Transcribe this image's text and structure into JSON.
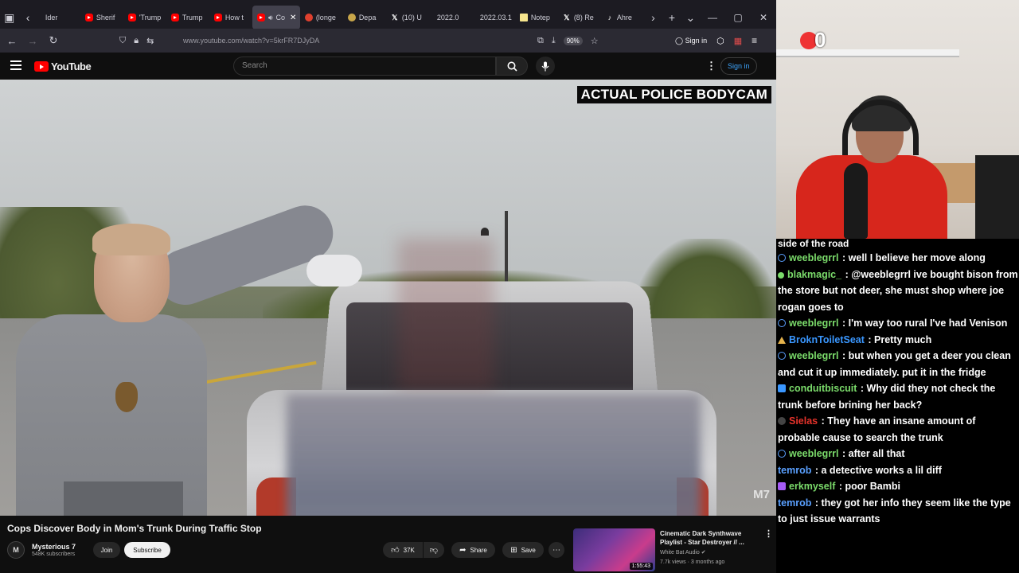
{
  "browser": {
    "tabs": [
      {
        "label": "Ider",
        "icon": "none",
        "active": false
      },
      {
        "label": "Sherif",
        "icon": "yt",
        "active": false
      },
      {
        "label": "'Trump",
        "icon": "yt",
        "active": false
      },
      {
        "label": "Trump",
        "icon": "yt",
        "active": false
      },
      {
        "label": "How t",
        "icon": "yt",
        "active": false
      },
      {
        "label": "Co",
        "icon": "yt",
        "active": true
      },
      {
        "label": "(longe",
        "icon": "red",
        "active": false
      },
      {
        "label": "Depa",
        "icon": "gold",
        "active": false
      },
      {
        "label": "(10) U",
        "icon": "x",
        "active": false
      },
      {
        "label": "2022.0",
        "icon": "none",
        "active": false
      },
      {
        "label": "2022.03.1",
        "icon": "none",
        "active": false
      },
      {
        "label": "Notep",
        "icon": "note",
        "active": false
      },
      {
        "label": "(8) Re",
        "icon": "x",
        "active": false
      },
      {
        "label": "Ahre",
        "icon": "tt",
        "active": false
      }
    ],
    "url": "www.youtube.com/watch?v=5krFR7DJyDA",
    "zoom": "90%",
    "sign_in": "Sign in"
  },
  "youtube": {
    "logo_text": "YouTube",
    "search_placeholder": "Search",
    "sign_in": "Sign in",
    "video": {
      "overlay_label": "ACTUAL POLICE BODYCAM",
      "watermark": "M7",
      "title": "Cops Discover Body in Mom's Trunk During Traffic Stop"
    },
    "channel": {
      "avatar_text": "M",
      "name": "Mysterious 7",
      "subscribers": "548K subscribers",
      "join_label": "Join",
      "subscribe_label": "Subscribe"
    },
    "actions": {
      "likes": "37K",
      "share": "Share",
      "save": "Save"
    },
    "recommended": {
      "title": "Cinematic Dark Synthwave Playlist - Star Destroyer // ...",
      "channel": "White Bat Audio",
      "meta": "7.7k views · 3 months ago",
      "duration": "1:55:43"
    }
  },
  "stream": {
    "cam_count": "0",
    "chat_top": "side of the road",
    "chat": [
      {
        "user": "weeblegrrl",
        "color": "#7bdc6b",
        "badge": "shield",
        "text": "well I believe her move along"
      },
      {
        "user": "blakmagic_",
        "color": "#7bdc6b",
        "badge": "lime",
        "text": "@weeblegrrl ive bought bison from the store but not deer, she must shop where joe rogan goes to"
      },
      {
        "user": "weeblegrrl",
        "color": "#7bdc6b",
        "badge": "shield",
        "text": "I'm way too rural I've had Venison"
      },
      {
        "user": "BroknToiletSeat",
        "color": "#3a97ff",
        "badge": "tri",
        "text": "Pretty much"
      },
      {
        "user": "weeblegrrl",
        "color": "#7bdc6b",
        "badge": "shield",
        "text": "but when you get a deer you clean and cut it up immediately. put it in the fridge"
      },
      {
        "user": "conduitbiscuit",
        "color": "#7bdc6b",
        "badge": "sq",
        "text": "Why did they not check the trunk before brining her back?"
      },
      {
        "user": "Sielas",
        "color": "#e8332b",
        "badge": "dark",
        "text": "They have an insane amount of probable cause to search the trunk"
      },
      {
        "user": "weeblegrrl",
        "color": "#7bdc6b",
        "badge": "shield",
        "text": "after all that"
      },
      {
        "user": "temrob",
        "color": "#5aa0ff",
        "badge": "none",
        "text": "a detective works a lil diff"
      },
      {
        "user": "erkmyself",
        "color": "#7bdc6b",
        "badge": "purple",
        "text": "poor Bambi"
      },
      {
        "user": "temrob",
        "color": "#5aa0ff",
        "badge": "none",
        "text": "they got her info they seem like the type to just issue warrants"
      }
    ]
  }
}
